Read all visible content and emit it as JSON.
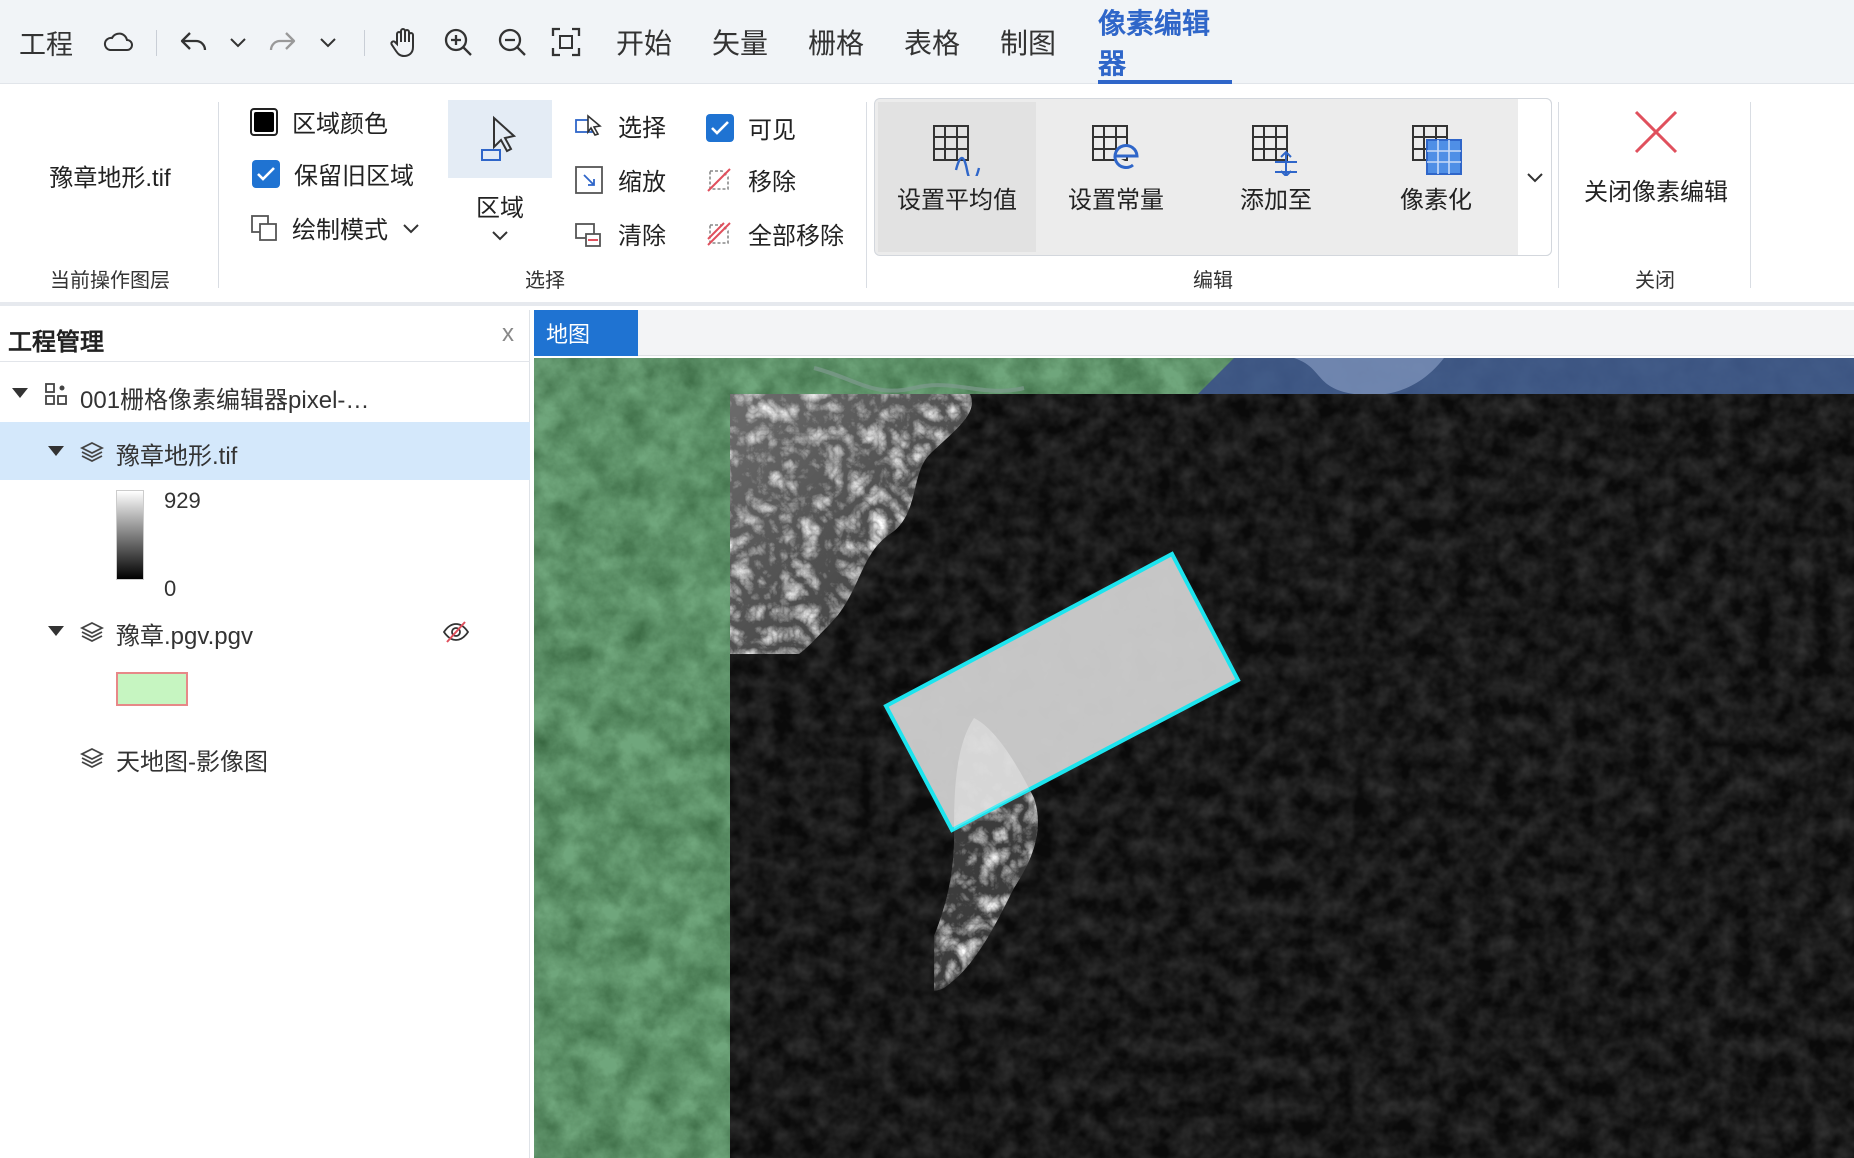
{
  "menubar": {
    "project": "工程",
    "tabs": [
      "开始",
      "矢量",
      "栅格",
      "表格",
      "制图",
      "像素编辑器"
    ],
    "active_tab": "像素编辑器"
  },
  "ribbon": {
    "current_layer": {
      "name": "豫章地形.tif",
      "group_label": "当前操作图层"
    },
    "select_group": {
      "region_color": "区域颜色",
      "keep_old_region": "保留旧区域",
      "draw_mode": "绘制模式",
      "region": "区域",
      "select": "选择",
      "zoom": "缩放",
      "clear": "清除",
      "visible": "可见",
      "remove": "移除",
      "remove_all": "全部移除",
      "group_label": "选择"
    },
    "edit_group": {
      "buttons": [
        "设置平均值",
        "设置常量",
        "添加至",
        "像素化"
      ],
      "group_label": "编辑"
    },
    "close_group": {
      "close_label": "关闭像素编辑",
      "group_label": "关闭"
    }
  },
  "panel": {
    "title": "工程管理",
    "close": "x",
    "project_name": "001栅格像素编辑器pixel-…",
    "layers": [
      {
        "name": "豫章地形.tif",
        "legend_max": "929",
        "legend_min": "0"
      },
      {
        "name": "豫章.pgv.pgv"
      },
      {
        "name": "天地图-影像图"
      }
    ]
  },
  "map": {
    "tab": "地图"
  },
  "colors": {
    "accent": "#2f66c9",
    "checkbox": "#1f73d2",
    "selection_row": "#d4e8fb",
    "region_outline": "#1de4ee",
    "pgv_swatch_fill": "#c6f5c1",
    "pgv_swatch_border": "#e78888",
    "close_x": "#e0505d"
  }
}
